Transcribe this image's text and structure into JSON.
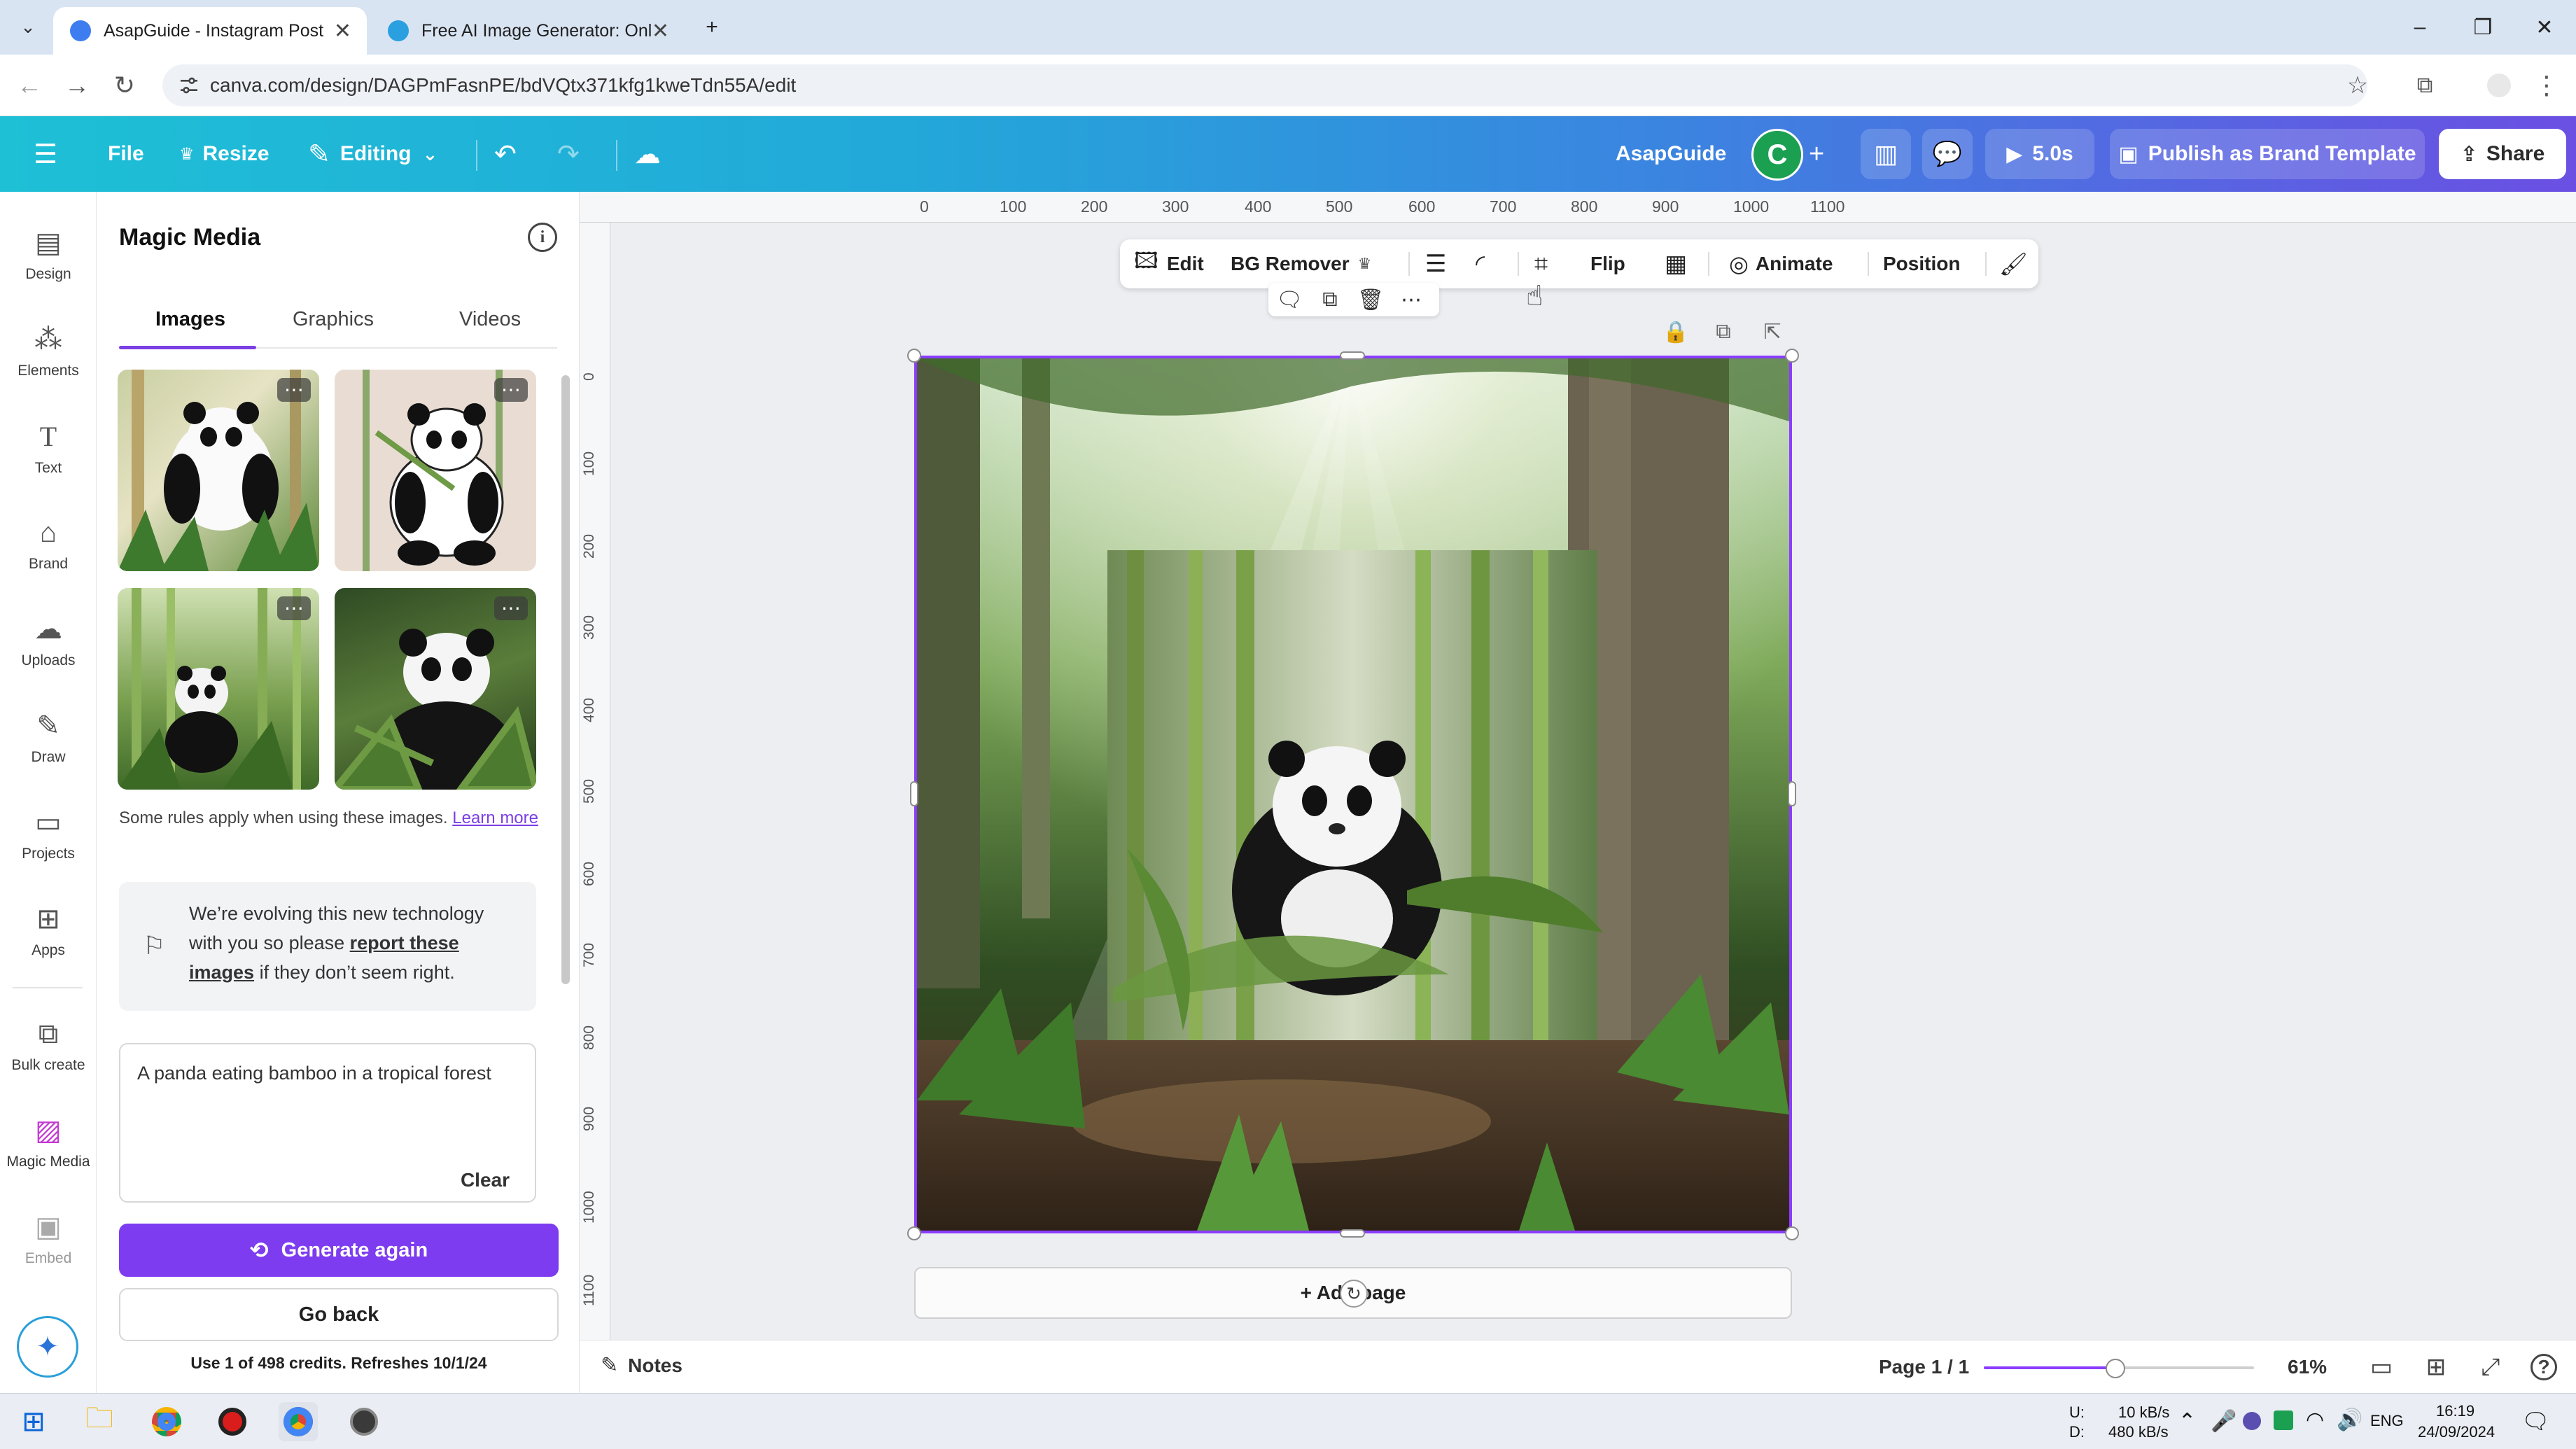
{
  "browser": {
    "tabs": [
      {
        "title": "AsapGuide - Instagram Post",
        "active": true
      },
      {
        "title": "Free AI Image Generator: Onlin",
        "active": false
      }
    ],
    "url": "canva.com/design/DAGPmFasnPE/bdVQtx371kfg1kweTdn55A/edit",
    "tab_close": "✕",
    "new_tab": "+"
  },
  "header": {
    "file": "File",
    "resize": "Resize",
    "editing": "Editing",
    "project_name": "AsapGuide",
    "avatar_letter": "C",
    "duration": "5.0s",
    "publish": "Publish as Brand Template",
    "share": "Share"
  },
  "rail": {
    "items": [
      {
        "label": "Design",
        "icon": "design-icon"
      },
      {
        "label": "Elements",
        "icon": "elements-icon"
      },
      {
        "label": "Text",
        "icon": "text-icon"
      },
      {
        "label": "Brand",
        "icon": "brand-icon"
      },
      {
        "label": "Uploads",
        "icon": "uploads-icon"
      },
      {
        "label": "Draw",
        "icon": "draw-icon"
      },
      {
        "label": "Projects",
        "icon": "projects-icon"
      },
      {
        "label": "Apps",
        "icon": "apps-icon"
      },
      {
        "label": "Bulk create",
        "icon": "bulk-create-icon"
      },
      {
        "label": "Magic Media",
        "icon": "magic-media-icon"
      },
      {
        "label": "Embed",
        "icon": "embed-icon"
      }
    ]
  },
  "panel": {
    "title": "Magic Media",
    "tabs": [
      "Images",
      "Graphics",
      "Videos"
    ],
    "active_tab": "Images",
    "rules_text": "Some rules apply when using these images.",
    "learn_more": "Learn more",
    "notice_pre": "We’re evolving this new technology with you so please",
    "notice_link": "report these images",
    "notice_post": "if they don’t seem right.",
    "prompt": "A panda eating bamboo in a tropical forest",
    "clear": "Clear",
    "generate": "Generate again",
    "go_back": "Go back",
    "credits": "Use 1 of 498 credits. Refreshes 10/1/24"
  },
  "toolbar": {
    "edit": "Edit",
    "bg_remover": "BG Remover",
    "flip": "Flip",
    "animate": "Animate",
    "position": "Position"
  },
  "ruler": {
    "top": [
      "0",
      "100",
      "200",
      "300",
      "400",
      "500",
      "600",
      "700",
      "800",
      "900",
      "1000",
      "1100"
    ],
    "left": [
      "0",
      "100",
      "200",
      "300",
      "400",
      "500",
      "600",
      "700",
      "800",
      "900",
      "1000",
      "1100"
    ]
  },
  "canvas": {
    "add_page": "+ Add page"
  },
  "bottom": {
    "notes": "Notes",
    "page": "Page 1 / 1",
    "zoom": "61%",
    "zoom_fraction": 0.61
  },
  "taskbar": {
    "net_up_label": "U:",
    "net_down_label": "D:",
    "net_up": "10 kB/s",
    "net_down": "480 kB/s",
    "lang": "ENG",
    "time": "16:19",
    "date": "24/09/2024"
  },
  "colors": {
    "accent": "#8b3dff",
    "generate_button": "#7d3cf0",
    "avatar": "#1aa050"
  }
}
